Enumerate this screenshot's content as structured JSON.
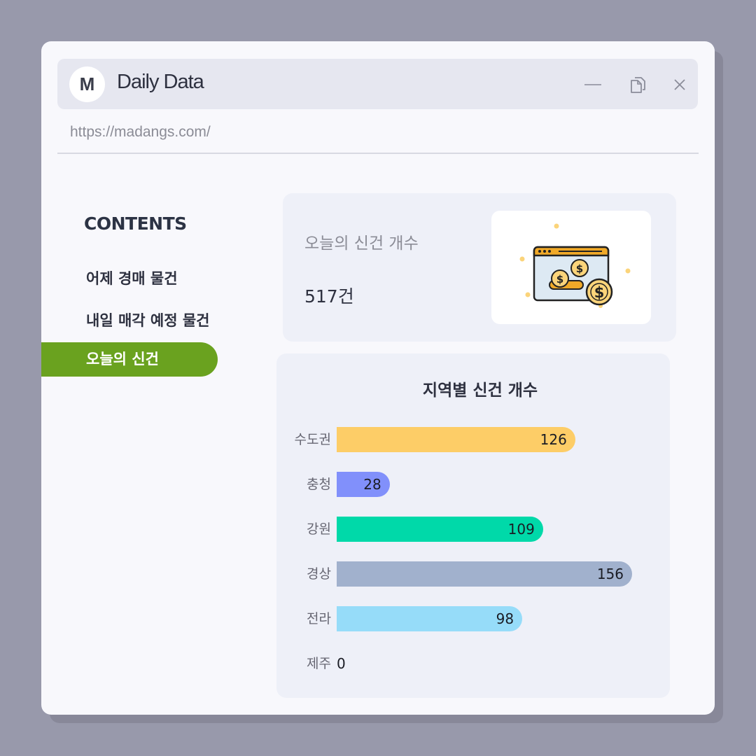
{
  "window": {
    "logo_letter": "M",
    "title": "Daily Data",
    "url": "https://madangs.com/"
  },
  "sidebar": {
    "heading": "CONTENTS",
    "items": [
      {
        "label": "어제 경매 물건",
        "active": false
      },
      {
        "label": "내일 매각 예정 물건",
        "active": false
      },
      {
        "label": "오늘의 신건",
        "active": true
      }
    ]
  },
  "summary": {
    "label": "오늘의 신건 개수",
    "value": "517건",
    "image_icon": "money-browser-icon"
  },
  "chart_data": {
    "type": "bar",
    "orientation": "horizontal",
    "title": "지역별 신건 개수",
    "categories": [
      "수도권",
      "충청",
      "강원",
      "경상",
      "전라",
      "제주"
    ],
    "values": [
      126,
      28,
      109,
      156,
      98,
      0
    ],
    "colors": [
      "#fdcd67",
      "#8190fb",
      "#00d9a9",
      "#a1b1cd",
      "#96dcf9",
      "#cccccc"
    ],
    "xlim": [
      0,
      160
    ],
    "xlabel": "",
    "ylabel": ""
  },
  "colors": {
    "accent": "#6aa21f",
    "background": "#9899ab"
  }
}
